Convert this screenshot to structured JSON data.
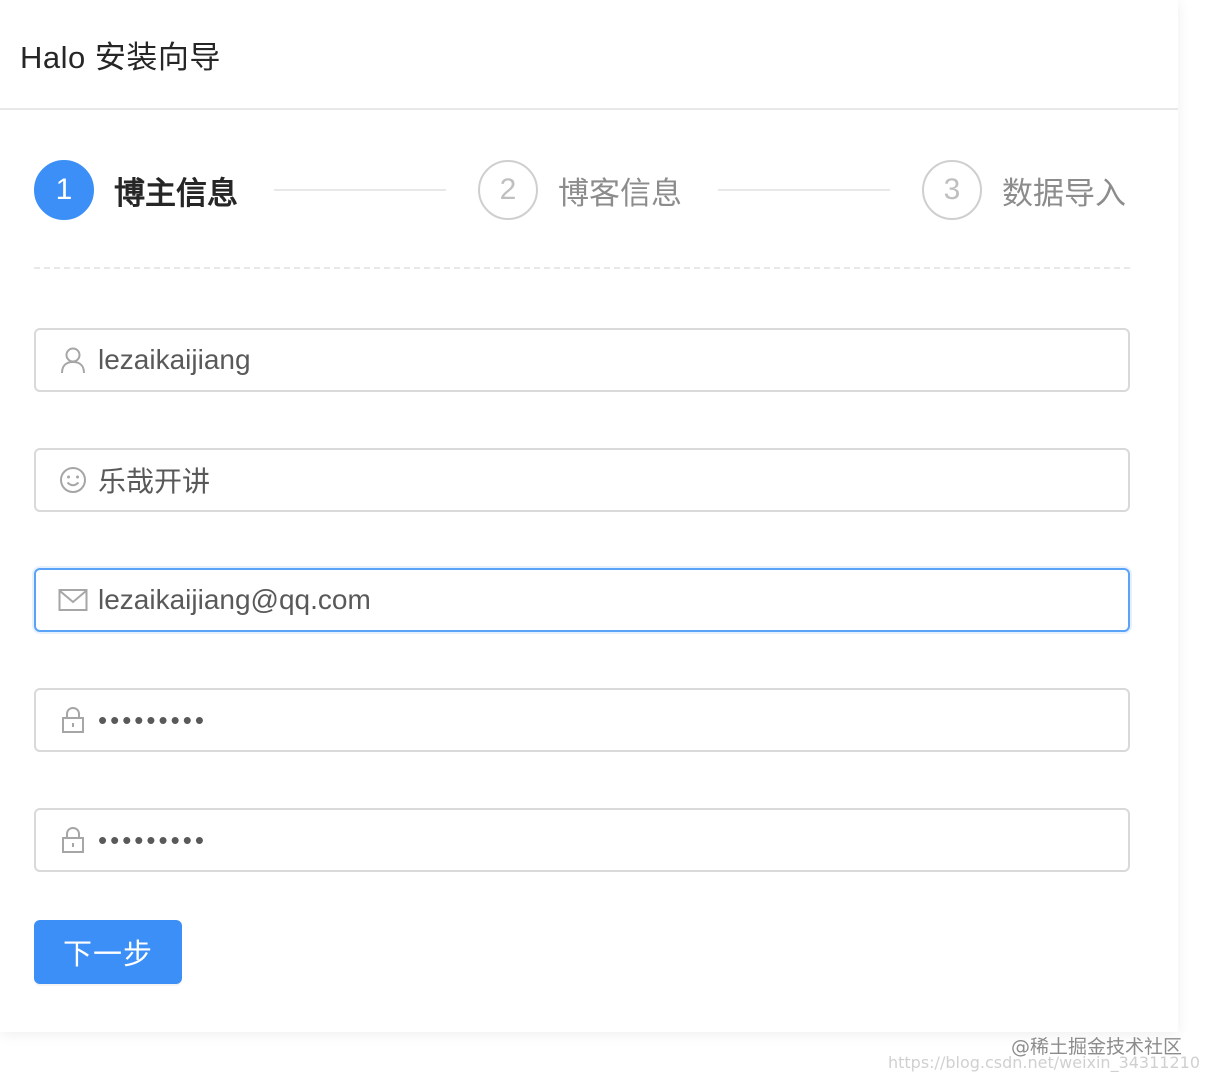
{
  "header": {
    "title": "Halo 安装向导"
  },
  "steps": [
    {
      "number": "1",
      "label": "博主信息",
      "state": "active"
    },
    {
      "number": "2",
      "label": "博客信息",
      "state": "wait"
    },
    {
      "number": "3",
      "label": "数据导入",
      "state": "wait"
    }
  ],
  "form": {
    "username": {
      "value": "lezaikaijiang",
      "icon": "user-icon"
    },
    "nickname": {
      "value": "乐哉开讲",
      "icon": "smile-icon"
    },
    "email": {
      "value": "lezaikaijiang@qq.com",
      "icon": "mail-icon"
    },
    "password": {
      "value": "•••••••••",
      "icon": "lock-icon"
    },
    "confirm_password": {
      "value": "•••••••••",
      "icon": "lock-icon"
    }
  },
  "actions": {
    "next_label": "下一步"
  },
  "colors": {
    "primary": "#3b8ff6",
    "border": "#d9d9d9",
    "text": "#262626"
  },
  "watermark": {
    "line1": "@稀土掘金技术社区",
    "line2": "https://blog.csdn.net/weixin_34311210"
  }
}
